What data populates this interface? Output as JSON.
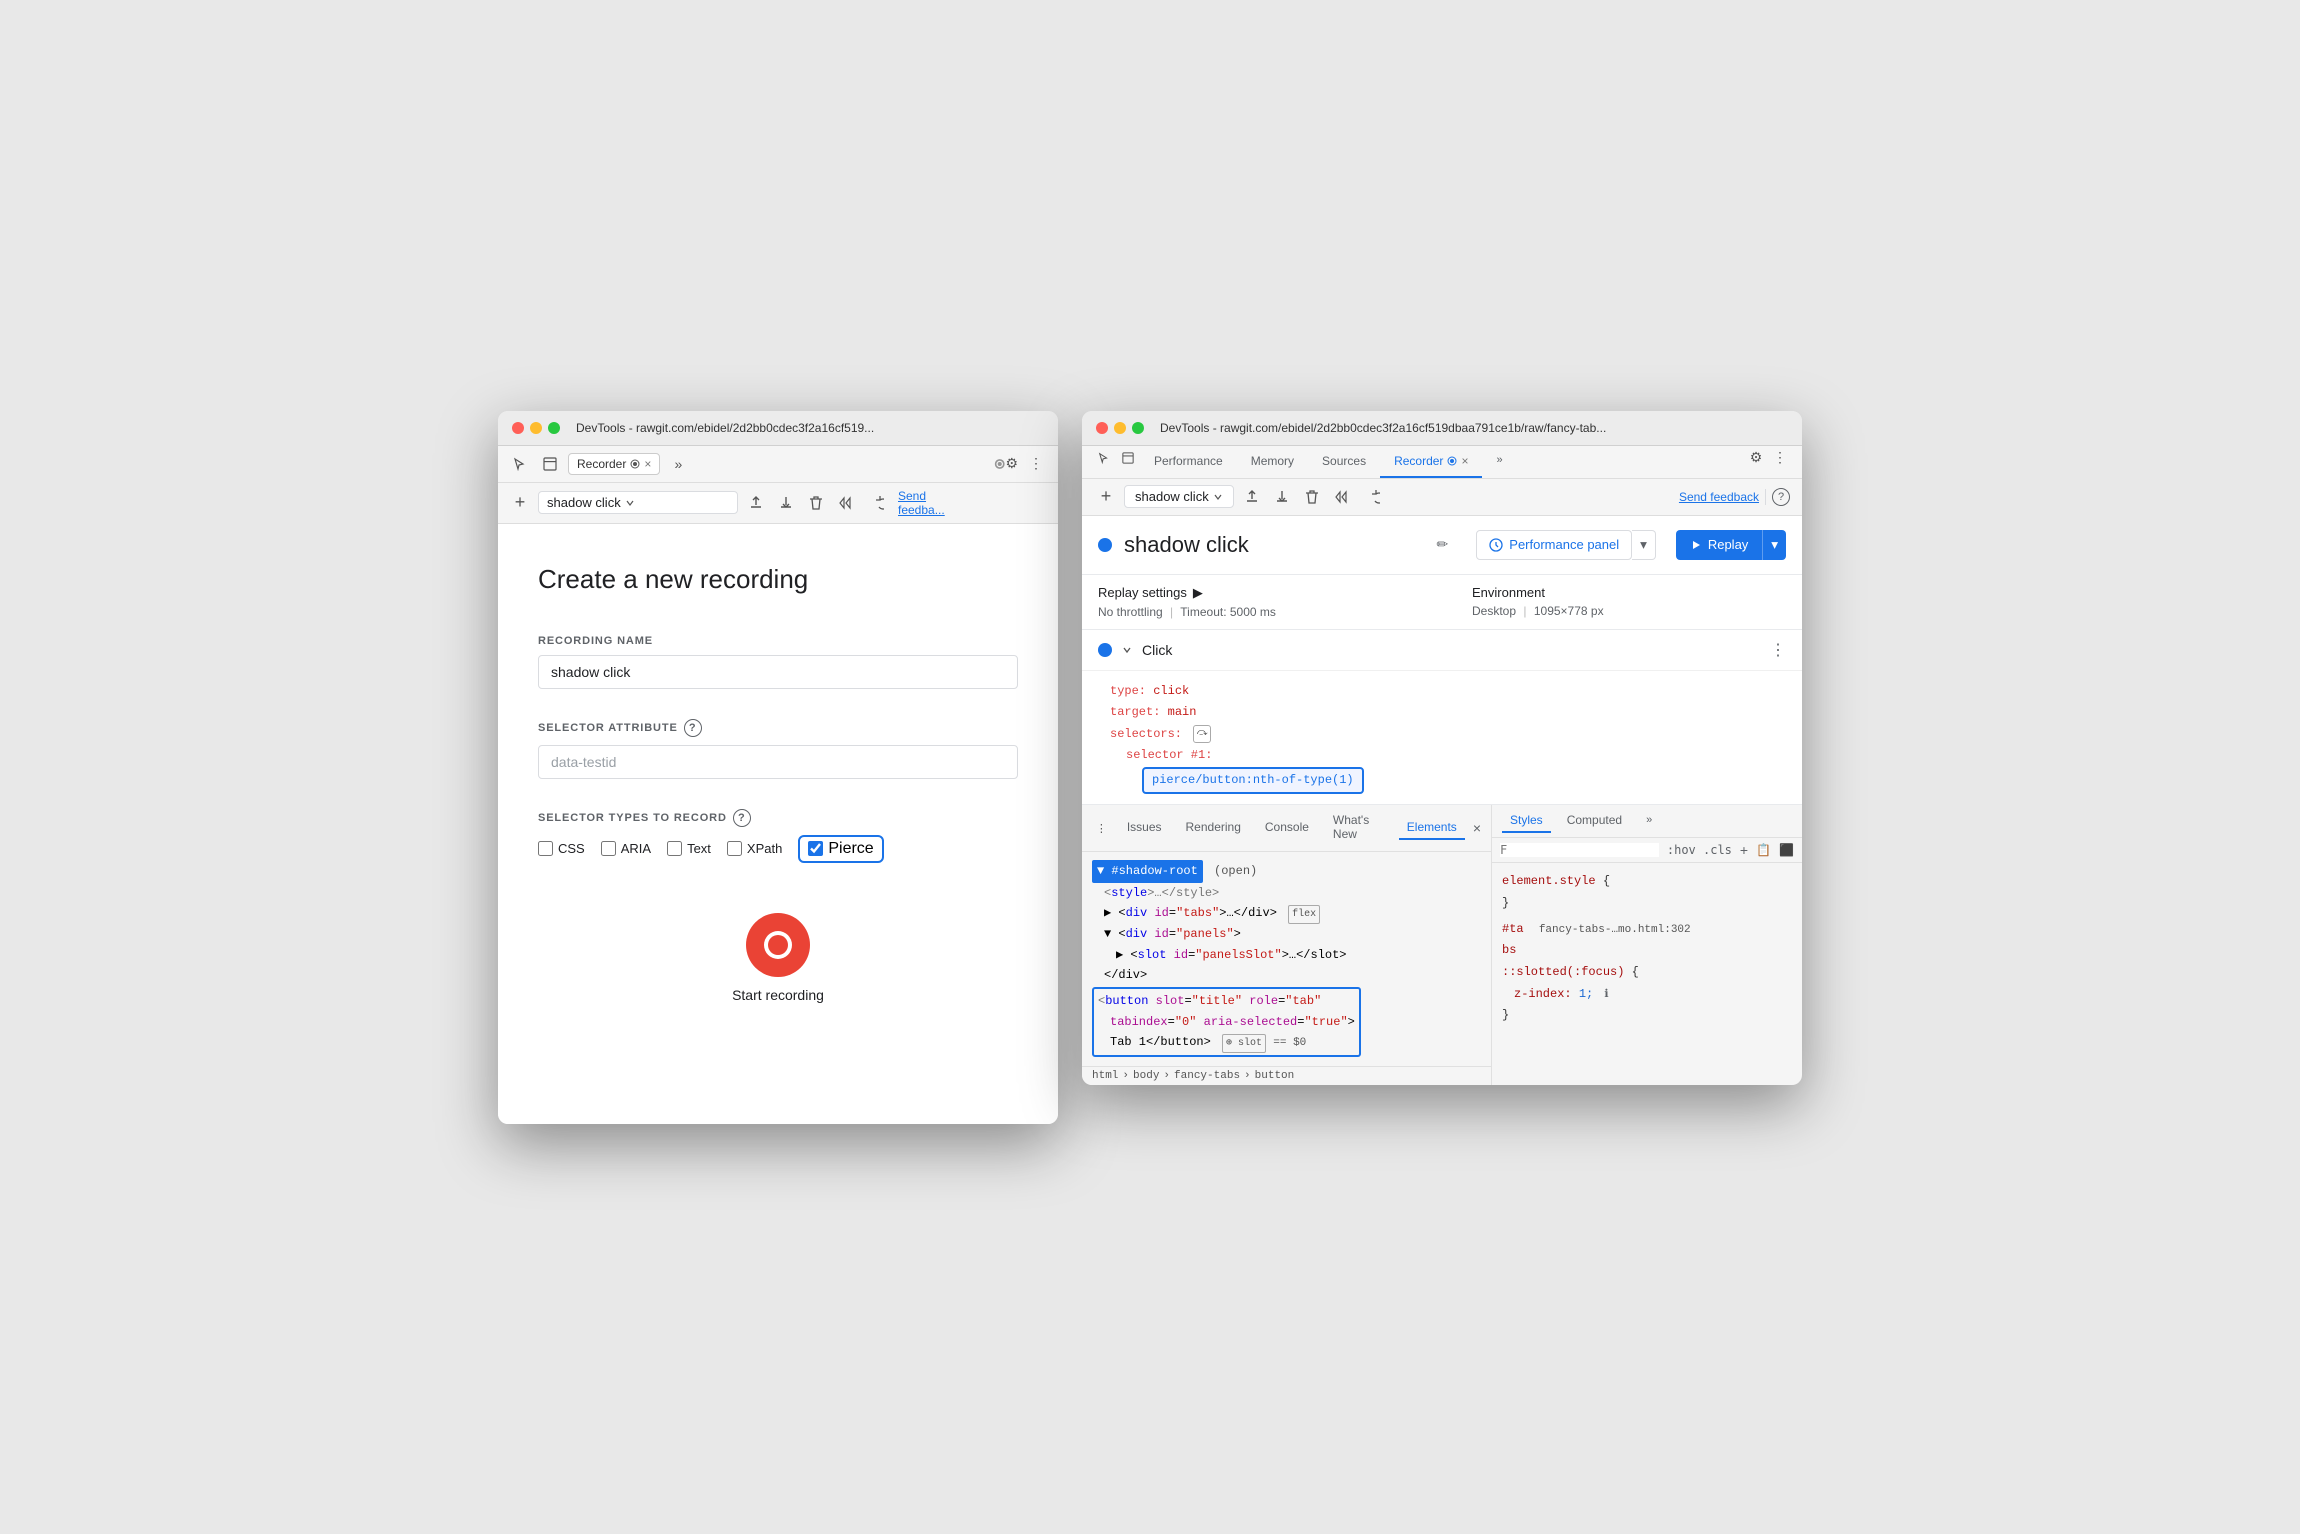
{
  "left_window": {
    "title": "DevTools - rawgit.com/ebidel/2d2bb0cdec3f2a16cf519...",
    "tab_label": "Recorder",
    "form": {
      "title": "Create a new recording",
      "recording_name_label": "RECORDING NAME",
      "recording_name_value": "shadow click",
      "selector_attr_label": "SELECTOR ATTRIBUTE",
      "selector_attr_placeholder": "data-testid",
      "selector_types_label": "SELECTOR TYPES TO RECORD",
      "checkboxes": [
        {
          "label": "CSS",
          "checked": false
        },
        {
          "label": "ARIA",
          "checked": false
        },
        {
          "label": "Text",
          "checked": false
        },
        {
          "label": "XPath",
          "checked": false
        },
        {
          "label": "Pierce",
          "checked": true
        }
      ],
      "start_recording_label": "Start recording"
    }
  },
  "right_window": {
    "title": "DevTools - rawgit.com/ebidel/2d2bb0cdec3f2a16cf519dbaa791ce1b/raw/fancy-tab...",
    "nav_tabs": [
      "Performance",
      "Memory",
      "Sources",
      "Recorder",
      ""
    ],
    "recording_name": "shadow click",
    "send_feedback": "Send feedback",
    "replay_settings": {
      "label": "Replay settings",
      "throttling": "No throttling",
      "timeout": "Timeout: 5000 ms",
      "environment_label": "Environment",
      "environment_value": "Desktop",
      "resolution": "1095×778 px"
    },
    "replay_btn": "Replay",
    "perf_btn": "Performance panel",
    "step": {
      "title": "Click",
      "code": {
        "type_key": "type:",
        "type_val": "click",
        "target_key": "target:",
        "target_val": "main",
        "selectors_key": "selectors:",
        "selector_num_label": "selector #1:",
        "selector_value": "pierce/button:nth-of-type(1)"
      }
    },
    "dom_panel": {
      "tabs": [
        "Issues",
        "Rendering",
        "Console",
        "What's New",
        "Elements"
      ],
      "active_tab": "Elements",
      "lines": [
        {
          "text": "▼ #shadow-root",
          "highlighted": true,
          "badge": "(open)"
        },
        {
          "text": "  <style>…</style>",
          "highlighted": false
        },
        {
          "text": "  ▶ <div id=\"tabs\">…</div>",
          "highlighted": false,
          "badge": "flex"
        },
        {
          "text": "  ▼ <div id=\"panels\">",
          "highlighted": false
        },
        {
          "text": "    ▶ <slot id=\"panelsSlot\">…</slot>",
          "highlighted": false
        },
        {
          "text": "  </div>",
          "highlighted": false
        }
      ],
      "button_line": "<button slot=\"title\" role=\"tab\"",
      "button_line2": "tabindex=\"0\" aria-selected=\"true\">",
      "button_line3": "Tab 1</button>",
      "slot_badge": "slot",
      "equals_badge": "== $0",
      "breadcrumb": [
        "html",
        "body",
        "fancy-tabs",
        "button"
      ]
    },
    "styles_panel": {
      "tabs": [
        "Styles",
        "Computed",
        ""
      ],
      "filter_placeholder": "F",
      "pseudo_states": ":hov  .cls",
      "rule1_selector": "element.style {",
      "rule1_close": "}",
      "rule2_ref": "#ta  fancy-tabs-…mo.html:302",
      "rule2_subject": "bs",
      "rule2_pseudo": "::slotted(:focus) {",
      "rule2_prop": "z-index: 1;",
      "rule2_close": "}"
    }
  }
}
